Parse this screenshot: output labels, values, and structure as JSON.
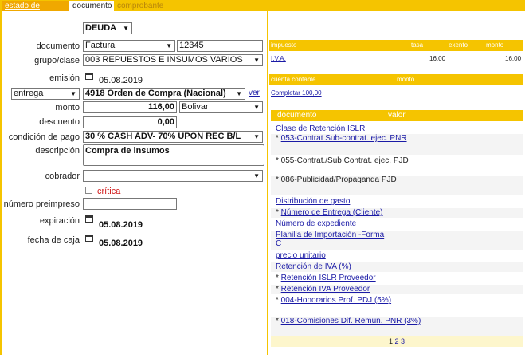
{
  "tabs": {
    "estado": "estado de cuenta",
    "documento": "documento",
    "comprobante": "comprobante"
  },
  "form": {
    "deuda_select": "DEUDA",
    "documento_label": "documento",
    "documento_type": "Factura",
    "documento_number": "12345",
    "grupo_label": "grupo/clase",
    "grupo_value": "003 REPUESTOS E INSUMOS VARIOS",
    "emision_label": "emisión",
    "emision_date": "05.08.2019",
    "entrega_select": "entrega",
    "orden_value": "4918 Orden de Compra (Nacional)",
    "ver_link": "ver",
    "monto_label": "monto",
    "monto_value": "116,00",
    "moneda_value": "Bolivar",
    "descuento_label": "descuento",
    "descuento_value": "0,00",
    "condicion_label": "condición de pago",
    "condicion_value": "30 % CASH ADV- 70% UPON REC B/L",
    "descripcion_label": "descripción",
    "descripcion_value": "Compra de insumos",
    "cobrador_label": "cobrador",
    "cobrador_value": "",
    "critica_label": "crítica",
    "preimpreso_label": "número preimpreso",
    "preimpreso_value": "",
    "expiracion_label": "expiración",
    "expiracion_date": "05.08.2019",
    "fecha_caja_label": "fecha de caja",
    "fecha_caja_date": "05.08.2019"
  },
  "impuesto_table": {
    "headers": {
      "impuesto": "impuesto",
      "tasa": "tasa",
      "exento": "exento",
      "monto": "monto"
    },
    "row": {
      "impuesto": "I.V.A.",
      "tasa": "",
      "exento": "16,00",
      "monto": "16,00"
    }
  },
  "cuenta_table": {
    "headers": {
      "cuenta": "cuenta contable",
      "monto": "monto"
    },
    "link": "Completar 100,00"
  },
  "documento_table": {
    "headers": {
      "documento": "documento",
      "valor": "valor"
    },
    "items": [
      {
        "prefix": "",
        "text": "Clase de Retención ISLR",
        "link": true
      },
      {
        "prefix": "* ",
        "text": "053-Contrat Sub-contrat. ejec. PNR",
        "link": true
      },
      {
        "prefix": "* ",
        "text": "055-Contrat./Sub Contrat. ejec. PJD",
        "link": false
      },
      {
        "prefix": "* ",
        "text": "086-Publicidad/Propaganda PJD",
        "link": false
      },
      {
        "prefix": "",
        "text": "Distribución de gasto",
        "link": true
      },
      {
        "prefix": "* ",
        "text": "Número de Entrega (Cliente)",
        "link": true
      },
      {
        "prefix": "",
        "text": "Número de expediente",
        "link": true
      },
      {
        "prefix": "",
        "text": "Planilla de Importación -Forma C",
        "link": true
      },
      {
        "prefix": "",
        "text": "precio unitario",
        "link": true
      },
      {
        "prefix": "",
        "text": "Retención de IVA (%)",
        "link": true
      },
      {
        "prefix": "* ",
        "text": "Retención ISLR Proveedor",
        "link": true
      },
      {
        "prefix": "* ",
        "text": "Retención IVA Proveedor",
        "link": true
      },
      {
        "prefix": "* ",
        "text": "004-Honorarios Prof. PDJ (5%)",
        "link": true
      },
      {
        "prefix": "* ",
        "text": "018-Comisiones Dif. Remun. PNR (3%)",
        "link": true
      }
    ],
    "pages": [
      "1",
      "2",
      "3"
    ]
  },
  "colors": {
    "accent": "#f5c400",
    "tab_active": "#f0a800",
    "link": "#1a1aa6",
    "critical": "#d11a1a"
  }
}
